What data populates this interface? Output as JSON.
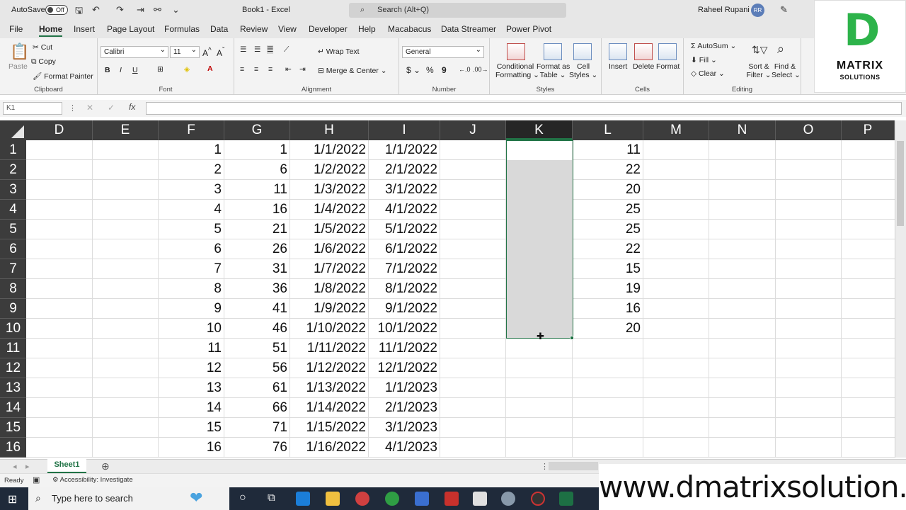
{
  "titlebar": {
    "autosave_label": "AutoSave",
    "autosave_state": "Off",
    "doc_title": "Book1  -  Excel",
    "search_placeholder": "Search (Alt+Q)",
    "user_name": "Raheel Rupani",
    "user_initials": "RR"
  },
  "tabs": [
    "File",
    "Home",
    "Insert",
    "Page Layout",
    "Formulas",
    "Data",
    "Review",
    "View",
    "Developer",
    "Help",
    "Macabacus",
    "Data Streamer",
    "Power Pivot"
  ],
  "ribbon": {
    "clipboard": {
      "paste": "Paste",
      "cut": "Cut",
      "copy": "Copy",
      "format_painter": "Format Painter",
      "label": "Clipboard"
    },
    "font": {
      "name": "Calibri",
      "size": "11",
      "label": "Font"
    },
    "alignment": {
      "wrap": "Wrap Text",
      "merge": "Merge & Center",
      "label": "Alignment"
    },
    "number": {
      "format": "General",
      "label": "Number"
    },
    "styles": {
      "cond1": "Conditional",
      "cond2": "Formatting",
      "fmt1": "Format as",
      "fmt2": "Table",
      "cell1": "Cell",
      "cell2": "Styles",
      "label": "Styles"
    },
    "cells": {
      "insert": "Insert",
      "delete": "Delete",
      "format": "Format",
      "label": "Cells"
    },
    "editing": {
      "autosum": "AutoSum",
      "fill": "Fill",
      "clear": "Clear",
      "sort1": "Sort &",
      "sort2": "Filter",
      "find1": "Find &",
      "find2": "Select",
      "label": "Editing"
    }
  },
  "namebox": "K1",
  "columns": [
    "D",
    "E",
    "F",
    "G",
    "H",
    "I",
    "J",
    "K",
    "L",
    "M",
    "N",
    "O",
    "P"
  ],
  "rows": [
    "1",
    "2",
    "3",
    "4",
    "5",
    "6",
    "7",
    "8",
    "9",
    "10",
    "11",
    "12",
    "13",
    "14",
    "15",
    "16"
  ],
  "colF": [
    "1",
    "2",
    "3",
    "4",
    "5",
    "6",
    "7",
    "8",
    "9",
    "10",
    "11",
    "12",
    "13",
    "14",
    "15",
    "16"
  ],
  "colG": [
    "1",
    "6",
    "11",
    "16",
    "21",
    "26",
    "31",
    "36",
    "41",
    "46",
    "51",
    "56",
    "61",
    "66",
    "71",
    "76"
  ],
  "colH": [
    "1/1/2022",
    "1/2/2022",
    "1/3/2022",
    "1/4/2022",
    "1/5/2022",
    "1/6/2022",
    "1/7/2022",
    "1/8/2022",
    "1/9/2022",
    "1/10/2022",
    "1/11/2022",
    "1/12/2022",
    "1/13/2022",
    "1/14/2022",
    "1/15/2022",
    "1/16/2022"
  ],
  "colI": [
    "1/1/2022",
    "2/1/2022",
    "3/1/2022",
    "4/1/2022",
    "5/1/2022",
    "6/1/2022",
    "7/1/2022",
    "8/1/2022",
    "9/1/2022",
    "10/1/2022",
    "11/1/2022",
    "12/1/2022",
    "1/1/2023",
    "2/1/2023",
    "3/1/2023",
    "4/1/2023"
  ],
  "colL": [
    "11",
    "22",
    "20",
    "25",
    "25",
    "22",
    "15",
    "19",
    "16",
    "20"
  ],
  "sheet_tab": "Sheet1",
  "status": {
    "ready": "Ready",
    "accessibility": "Accessibility: Investigate"
  },
  "taskbar": {
    "search": "Type here to search"
  },
  "logo": {
    "line1": "MATRIX",
    "line2": "SOLUTIONS",
    "letter": "D"
  },
  "watermark": "www.dmatrixsolution.com",
  "colors": {
    "accent": "#217346",
    "header_bg": "#3c3c3c",
    "selection": "#d9d9d9"
  }
}
